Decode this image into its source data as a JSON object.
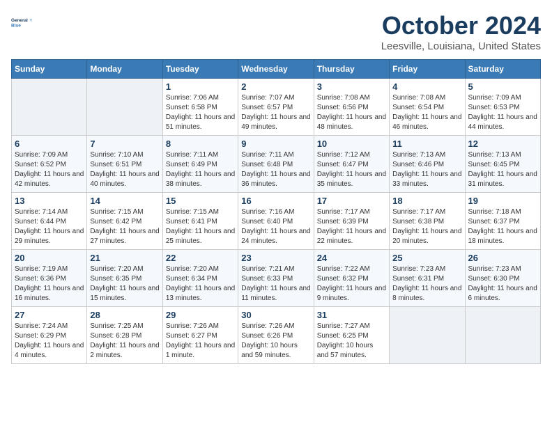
{
  "header": {
    "logo_line1": "General",
    "logo_line2": "Blue",
    "month": "October 2024",
    "location": "Leesville, Louisiana, United States"
  },
  "weekdays": [
    "Sunday",
    "Monday",
    "Tuesday",
    "Wednesday",
    "Thursday",
    "Friday",
    "Saturday"
  ],
  "weeks": [
    [
      {
        "day": "",
        "info": ""
      },
      {
        "day": "",
        "info": ""
      },
      {
        "day": "1",
        "info": "Sunrise: 7:06 AM\nSunset: 6:58 PM\nDaylight: 11 hours and 51 minutes."
      },
      {
        "day": "2",
        "info": "Sunrise: 7:07 AM\nSunset: 6:57 PM\nDaylight: 11 hours and 49 minutes."
      },
      {
        "day": "3",
        "info": "Sunrise: 7:08 AM\nSunset: 6:56 PM\nDaylight: 11 hours and 48 minutes."
      },
      {
        "day": "4",
        "info": "Sunrise: 7:08 AM\nSunset: 6:54 PM\nDaylight: 11 hours and 46 minutes."
      },
      {
        "day": "5",
        "info": "Sunrise: 7:09 AM\nSunset: 6:53 PM\nDaylight: 11 hours and 44 minutes."
      }
    ],
    [
      {
        "day": "6",
        "info": "Sunrise: 7:09 AM\nSunset: 6:52 PM\nDaylight: 11 hours and 42 minutes."
      },
      {
        "day": "7",
        "info": "Sunrise: 7:10 AM\nSunset: 6:51 PM\nDaylight: 11 hours and 40 minutes."
      },
      {
        "day": "8",
        "info": "Sunrise: 7:11 AM\nSunset: 6:49 PM\nDaylight: 11 hours and 38 minutes."
      },
      {
        "day": "9",
        "info": "Sunrise: 7:11 AM\nSunset: 6:48 PM\nDaylight: 11 hours and 36 minutes."
      },
      {
        "day": "10",
        "info": "Sunrise: 7:12 AM\nSunset: 6:47 PM\nDaylight: 11 hours and 35 minutes."
      },
      {
        "day": "11",
        "info": "Sunrise: 7:13 AM\nSunset: 6:46 PM\nDaylight: 11 hours and 33 minutes."
      },
      {
        "day": "12",
        "info": "Sunrise: 7:13 AM\nSunset: 6:45 PM\nDaylight: 11 hours and 31 minutes."
      }
    ],
    [
      {
        "day": "13",
        "info": "Sunrise: 7:14 AM\nSunset: 6:44 PM\nDaylight: 11 hours and 29 minutes."
      },
      {
        "day": "14",
        "info": "Sunrise: 7:15 AM\nSunset: 6:42 PM\nDaylight: 11 hours and 27 minutes."
      },
      {
        "day": "15",
        "info": "Sunrise: 7:15 AM\nSunset: 6:41 PM\nDaylight: 11 hours and 25 minutes."
      },
      {
        "day": "16",
        "info": "Sunrise: 7:16 AM\nSunset: 6:40 PM\nDaylight: 11 hours and 24 minutes."
      },
      {
        "day": "17",
        "info": "Sunrise: 7:17 AM\nSunset: 6:39 PM\nDaylight: 11 hours and 22 minutes."
      },
      {
        "day": "18",
        "info": "Sunrise: 7:17 AM\nSunset: 6:38 PM\nDaylight: 11 hours and 20 minutes."
      },
      {
        "day": "19",
        "info": "Sunrise: 7:18 AM\nSunset: 6:37 PM\nDaylight: 11 hours and 18 minutes."
      }
    ],
    [
      {
        "day": "20",
        "info": "Sunrise: 7:19 AM\nSunset: 6:36 PM\nDaylight: 11 hours and 16 minutes."
      },
      {
        "day": "21",
        "info": "Sunrise: 7:20 AM\nSunset: 6:35 PM\nDaylight: 11 hours and 15 minutes."
      },
      {
        "day": "22",
        "info": "Sunrise: 7:20 AM\nSunset: 6:34 PM\nDaylight: 11 hours and 13 minutes."
      },
      {
        "day": "23",
        "info": "Sunrise: 7:21 AM\nSunset: 6:33 PM\nDaylight: 11 hours and 11 minutes."
      },
      {
        "day": "24",
        "info": "Sunrise: 7:22 AM\nSunset: 6:32 PM\nDaylight: 11 hours and 9 minutes."
      },
      {
        "day": "25",
        "info": "Sunrise: 7:23 AM\nSunset: 6:31 PM\nDaylight: 11 hours and 8 minutes."
      },
      {
        "day": "26",
        "info": "Sunrise: 7:23 AM\nSunset: 6:30 PM\nDaylight: 11 hours and 6 minutes."
      }
    ],
    [
      {
        "day": "27",
        "info": "Sunrise: 7:24 AM\nSunset: 6:29 PM\nDaylight: 11 hours and 4 minutes."
      },
      {
        "day": "28",
        "info": "Sunrise: 7:25 AM\nSunset: 6:28 PM\nDaylight: 11 hours and 2 minutes."
      },
      {
        "day": "29",
        "info": "Sunrise: 7:26 AM\nSunset: 6:27 PM\nDaylight: 11 hours and 1 minute."
      },
      {
        "day": "30",
        "info": "Sunrise: 7:26 AM\nSunset: 6:26 PM\nDaylight: 10 hours and 59 minutes."
      },
      {
        "day": "31",
        "info": "Sunrise: 7:27 AM\nSunset: 6:25 PM\nDaylight: 10 hours and 57 minutes."
      },
      {
        "day": "",
        "info": ""
      },
      {
        "day": "",
        "info": ""
      }
    ]
  ]
}
